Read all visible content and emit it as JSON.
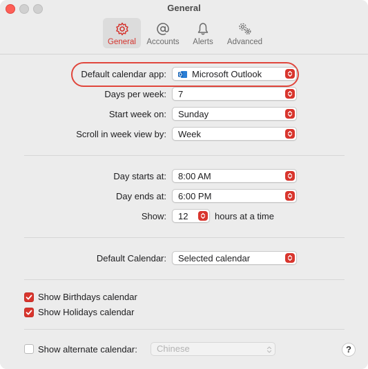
{
  "window": {
    "title": "General"
  },
  "tabs": [
    {
      "label": "General",
      "icon": "gear-icon",
      "active": true
    },
    {
      "label": "Accounts",
      "icon": "at-sign-icon",
      "active": false
    },
    {
      "label": "Alerts",
      "icon": "bell-icon",
      "active": false
    },
    {
      "label": "Advanced",
      "icon": "gears-icon",
      "active": false
    }
  ],
  "settings": {
    "default_app": {
      "label": "Default calendar app:",
      "value": "Microsoft Outlook",
      "icon": "outlook-icon"
    },
    "days_per_week": {
      "label": "Days per week:",
      "value": "7"
    },
    "start_week": {
      "label": "Start week on:",
      "value": "Sunday"
    },
    "scroll_week": {
      "label": "Scroll in week view by:",
      "value": "Week"
    },
    "day_starts": {
      "label": "Day starts at:",
      "value": "8:00 AM"
    },
    "day_ends": {
      "label": "Day ends at:",
      "value": "6:00 PM"
    },
    "show": {
      "label": "Show:",
      "value": "12",
      "suffix": "hours at a time"
    },
    "default_calendar": {
      "label": "Default Calendar:",
      "value": "Selected calendar"
    },
    "birthdays": {
      "label": "Show Birthdays calendar",
      "checked": true
    },
    "holidays": {
      "label": "Show Holidays calendar",
      "checked": true
    },
    "alternate": {
      "label": "Show alternate calendar:",
      "checked": false,
      "value": "Chinese"
    }
  },
  "help": {
    "label": "?"
  },
  "colors": {
    "accent": "#d8352d",
    "highlight": "#e0453b"
  }
}
